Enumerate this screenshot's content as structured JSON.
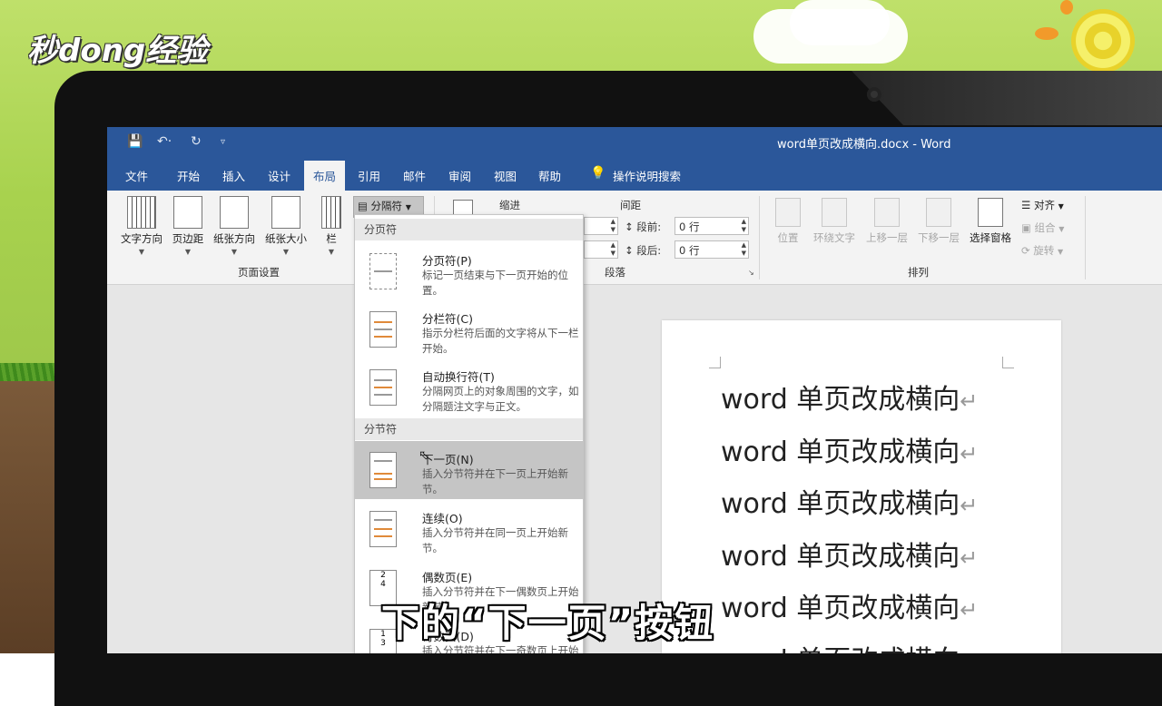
{
  "watermark": {
    "logo_text": "秒dong经验"
  },
  "titlebar": {
    "save_icon": "save-icon",
    "undo_icon": "undo-icon",
    "redo_icon": "redo-icon",
    "customize_icon": "chevron-down-icon",
    "title": "word单页改成横向.docx  -  Word"
  },
  "menu": {
    "tabs": [
      "文件",
      "开始",
      "插入",
      "设计",
      "布局",
      "引用",
      "邮件",
      "审阅",
      "视图",
      "帮助"
    ],
    "active_tab": "布局",
    "tell_me": "操作说明搜索"
  },
  "ribbon": {
    "page_setup": {
      "buttons": [
        "文字方向",
        "页边距",
        "纸张方向",
        "纸张大小",
        "栏"
      ],
      "breaks_button": "分隔符",
      "group_label": "页面设置"
    },
    "paragraph": {
      "indent_label": "缩进",
      "spacing_label": "间距",
      "before_label": "段前:",
      "before_value": "0 行",
      "after_label": "段后:",
      "after_value": "0 行",
      "group_label": "段落"
    },
    "arrange": {
      "buttons": [
        "位置",
        "环绕文字",
        "上移一层",
        "下移一层",
        "选择窗格"
      ],
      "align": "对齐",
      "group": "组合",
      "rotate": "旋转",
      "group_label": "排列"
    }
  },
  "dropdown": {
    "page_breaks_header": "分页符",
    "section_breaks_header": "分节符",
    "items": [
      {
        "title": "分页符(P)",
        "desc": "标记一页结束与下一页开始的位置。"
      },
      {
        "title": "分栏符(C)",
        "desc": "指示分栏符后面的文字将从下一栏开始。"
      },
      {
        "title": "自动换行符(T)",
        "desc": "分隔网页上的对象周围的文字，如分隔题注文字与正文。"
      },
      {
        "title": "下一页(N)",
        "desc": "插入分节符并在下一页上开始新节。"
      },
      {
        "title": "连续(O)",
        "desc": "插入分节符并在同一页上开始新节。"
      },
      {
        "title": "偶数页(E)",
        "desc": "插入分节符并在下一偶数页上开始新节。"
      },
      {
        "title": "奇数页(D)",
        "desc": "插入分节符并在下一奇数页上开始新节。"
      }
    ]
  },
  "document": {
    "lines": [
      "word 单页改成横向",
      "word 单页改成横向",
      "word 单页改成横向",
      "word 单页改成横向",
      "word 单页改成横向",
      "word 单页改成横向"
    ]
  },
  "subtitle": "下的“下一页”按钮"
}
